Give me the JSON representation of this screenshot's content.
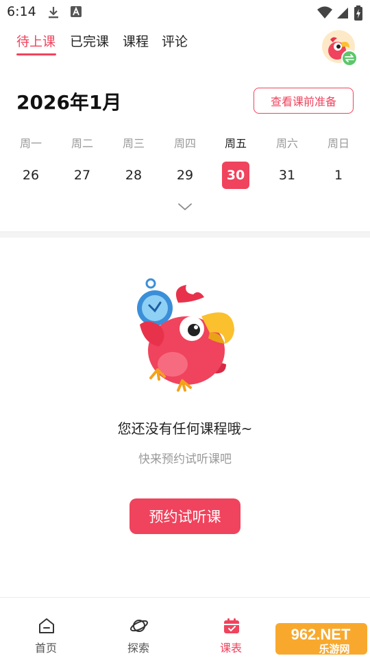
{
  "status_bar": {
    "time": "6:14"
  },
  "tabs": [
    {
      "label": "待上课",
      "active": true
    },
    {
      "label": "已完课",
      "active": false
    },
    {
      "label": "课程",
      "active": false
    },
    {
      "label": "评论",
      "active": false
    }
  ],
  "calendar": {
    "month_title": "2026年1月",
    "prep_button": "查看课前准备",
    "weekdays": [
      "周一",
      "周二",
      "周三",
      "周四",
      "周五",
      "周六",
      "周日"
    ],
    "dates": [
      "26",
      "27",
      "28",
      "29",
      "30",
      "31",
      "1"
    ],
    "selected_index": 4
  },
  "empty_state": {
    "title": "您还没有任何课程哦~",
    "subtitle": "快来预约试听课吧",
    "button": "预约试听课"
  },
  "bottom_nav": [
    {
      "label": "首页",
      "icon": "home-icon",
      "active": false
    },
    {
      "label": "探索",
      "icon": "planet-icon",
      "active": false
    },
    {
      "label": "课表",
      "icon": "calendar-icon",
      "active": true
    }
  ],
  "watermark": {
    "text_top": "962.NET",
    "text_bottom": "乐游网"
  },
  "colors": {
    "accent": "#f0435d",
    "muted": "#999999",
    "success": "#5cc76a"
  }
}
